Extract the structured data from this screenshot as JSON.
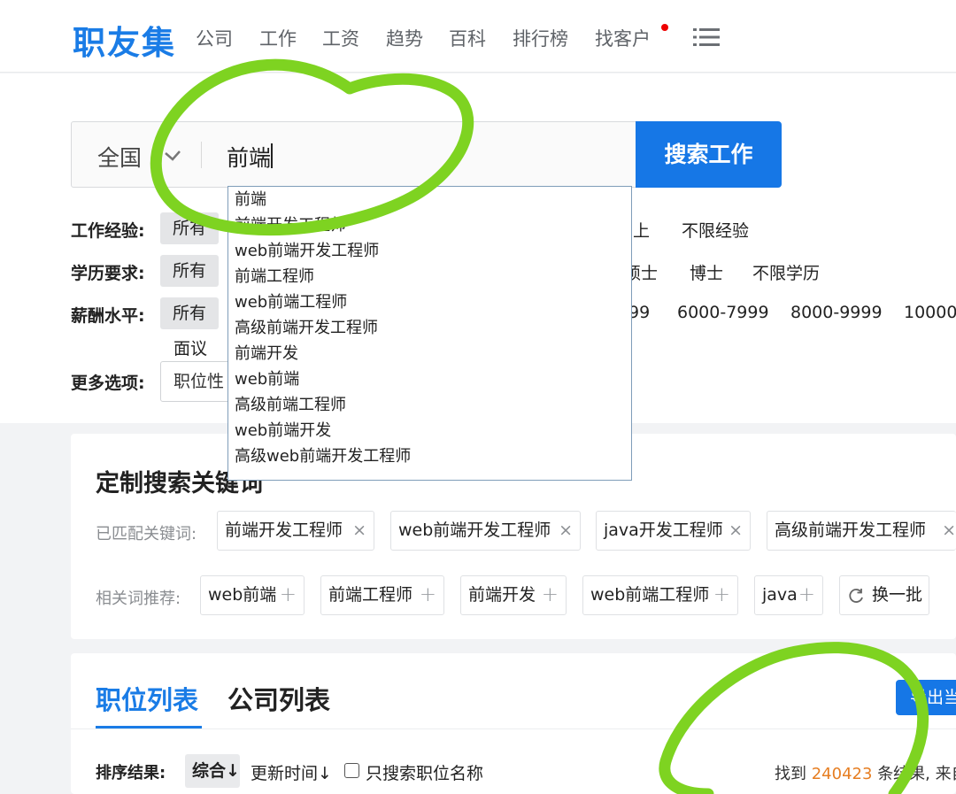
{
  "header": {
    "logo": "职友集",
    "nav": [
      "公司",
      "工作",
      "工资",
      "趋势",
      "百科",
      "排行榜",
      "找客户"
    ],
    "notification_dot_color": "#e00000",
    "menu_icon": "hamburger-menu-icon"
  },
  "search": {
    "region": "全国",
    "query": "前端",
    "button": "搜索工作",
    "suggestions": [
      "前端",
      "前端开发工程师",
      "web前端开发工程师",
      "前端工程师",
      "web前端工程师",
      "高级前端开发工程师",
      "前端开发",
      "web前端",
      "高级前端工程师",
      "web前端开发",
      "高级web前端开发工程师"
    ]
  },
  "filters": {
    "experience": {
      "label": "工作经验:",
      "selected": "所有",
      "tail_fragment": "上",
      "unlimited": "不限经验"
    },
    "education": {
      "label": "学历要求:",
      "selected": "所有",
      "fragment": "硕士",
      "phd": "博士",
      "unlimited": "不限学历"
    },
    "salary": {
      "label": "薪酬水平:",
      "selected": "所有",
      "fragment": "99",
      "ranges": [
        "6000-7999",
        "8000-9999",
        "10000-"
      ],
      "negotiable": "面议"
    },
    "more": {
      "label": "更多选项:",
      "select": "职位性"
    }
  },
  "custom_keywords": {
    "title": "定制搜索关键词",
    "matched_label": "已匹配关键词:",
    "matched": [
      "前端开发工程师",
      "web前端开发工程师",
      "java开发工程师",
      "高级前端开发工程师"
    ],
    "related_label": "相关词推荐:",
    "related": [
      "web前端",
      "前端工程师",
      "前端开发",
      "web前端工程师",
      "java"
    ],
    "refresh": "换一批"
  },
  "job_list": {
    "tabs": [
      "职位列表",
      "公司列表"
    ],
    "export_button": "导出当",
    "sort_label": "排序结果:",
    "sort_default": "综合↓",
    "sort_time": "更新时间↓",
    "only_title": "只搜索职位名称",
    "result_prefix": "找到",
    "result_count": "240423",
    "result_suffix": "条结果, 来自"
  },
  "colors": {
    "brand_blue": "#1a7ce6",
    "button_blue": "#1677e6",
    "marker_green": "#7ed321",
    "result_orange": "#e67e22"
  }
}
